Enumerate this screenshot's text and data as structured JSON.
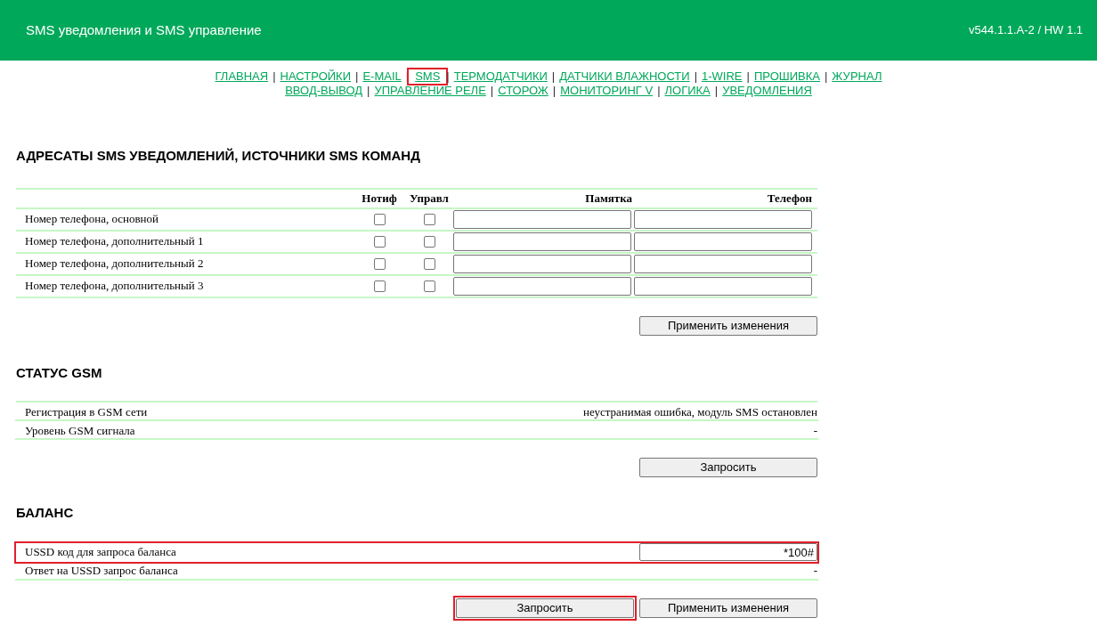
{
  "header": {
    "title": "SMS уведомления и SMS управление",
    "version": "v544.1.1.A-2 / HW 1.1"
  },
  "nav": {
    "separator": "|",
    "lines": [
      [
        {
          "label": "ГЛАВНАЯ",
          "highlighted": false
        },
        {
          "label": "НАСТРОЙКИ",
          "highlighted": false
        },
        {
          "label": "E-MAIL",
          "highlighted": false
        },
        {
          "label": "SMS",
          "highlighted": true
        },
        {
          "label": "ТЕРМОДАТЧИКИ",
          "highlighted": false
        },
        {
          "label": "ДАТЧИКИ ВЛАЖНОСТИ",
          "highlighted": false
        },
        {
          "label": "1-WIRE",
          "highlighted": false
        },
        {
          "label": "ПРОШИВКА",
          "highlighted": false
        },
        {
          "label": "ЖУРНАЛ",
          "highlighted": false
        }
      ],
      [
        {
          "label": "ВВОД-ВЫВОД",
          "highlighted": false
        },
        {
          "label": "УПРАВЛЕНИЕ РЕЛЕ",
          "highlighted": false
        },
        {
          "label": "СТОРОЖ",
          "highlighted": false
        },
        {
          "label": "МОНИТОРИНГ V",
          "highlighted": false
        },
        {
          "label": "ЛОГИКА",
          "highlighted": false
        },
        {
          "label": "УВЕДОМЛЕНИЯ",
          "highlighted": false
        }
      ]
    ]
  },
  "recipients": {
    "title": "АДРЕСАТЫ SMS УВЕДОМЛЕНИЙ, ИСТОЧНИКИ SMS КОМАНД",
    "columns": [
      "Нотиф",
      "Управл",
      "Памятка",
      "Телефон"
    ],
    "rows": [
      {
        "label": "Номер телефона, основной",
        "notify": false,
        "control": false
      },
      {
        "label": "Номер телефона, дополнительный 1",
        "notify": false,
        "control": false
      },
      {
        "label": "Номер телефона, дополнительный 2",
        "notify": false,
        "control": false
      },
      {
        "label": "Номер телефона, дополнительный 3",
        "notify": false,
        "control": false
      }
    ],
    "buttons": [
      {
        "label": "Применить изменения",
        "highlighted": false
      }
    ]
  },
  "gsm": {
    "title": "СТАТУС GSM",
    "rows": [
      {
        "kind": "text",
        "label": "Регистрация в GSM сети",
        "value": "неустранимая ошибка, модуль SMS остановлен",
        "highlighted": false
      },
      {
        "kind": "text",
        "label": "Уровень GSM сигнала",
        "value": "-",
        "highlighted": false
      }
    ],
    "buttons": [
      {
        "label": "Запросить",
        "highlighted": false
      }
    ]
  },
  "balance": {
    "title": "БАЛАНС",
    "rows": [
      {
        "kind": "input",
        "label": "USSD код для запроса баланса",
        "value": "*100#",
        "highlighted": true
      },
      {
        "kind": "text",
        "label": "Ответ на USSD запрос баланса",
        "value": "-",
        "highlighted": false
      }
    ],
    "buttons": [
      {
        "label": "Запросить",
        "highlighted": true
      },
      {
        "label": "Применить изменения",
        "highlighted": false
      }
    ]
  }
}
